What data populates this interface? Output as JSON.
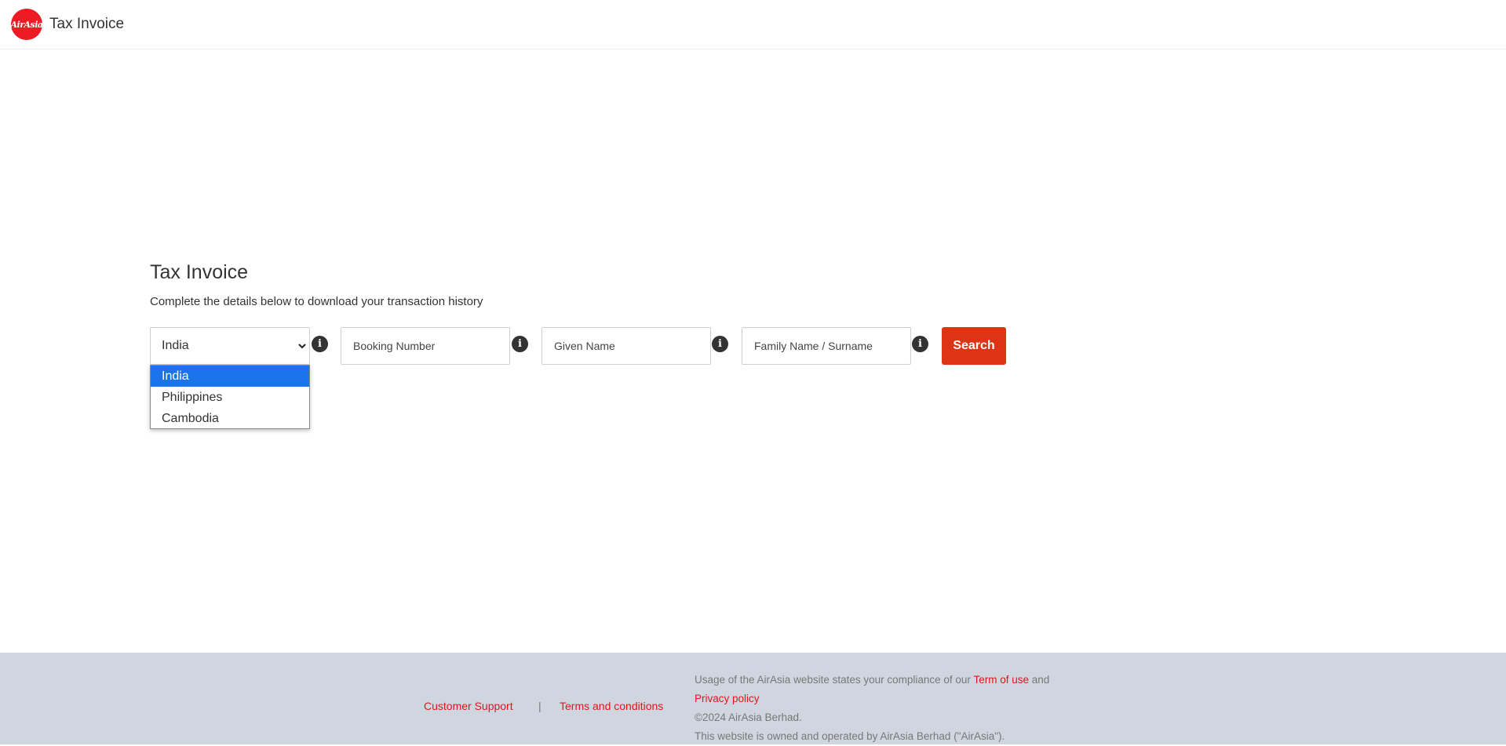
{
  "header": {
    "logo_text": "AirAsia",
    "title": "Tax Invoice"
  },
  "main": {
    "title": "Tax Invoice",
    "subtitle": "Complete the details below to download your transaction history",
    "country_select": {
      "value": "India",
      "options": [
        "India",
        "Philippines",
        "Cambodia"
      ]
    },
    "booking_number": {
      "placeholder": "Booking Number",
      "value": ""
    },
    "given_name": {
      "placeholder": "Given Name",
      "value": ""
    },
    "family_name": {
      "placeholder": "Family Name / Surname",
      "value": ""
    },
    "search_label": "Search",
    "info_icon_glyph": "i"
  },
  "footer": {
    "customer_support": "Customer Support",
    "separator": "|",
    "terms": "Terms and conditions",
    "legal_prefix": "Usage of the AirAsia website states your compliance of our",
    "term_of_use": "Term of use",
    "legal_and": "and",
    "privacy_policy": "Privacy policy",
    "copyright": "©2024 AirAsia Berhad.",
    "ownership": "This website is owned and operated by AirAsia Berhad (\"AirAsia\")."
  },
  "colors": {
    "brand_red": "#ed1c24",
    "search_button": "#dc3414",
    "footer_bg": "#d0d6e0",
    "link_red": "#e0141e",
    "dropdown_highlight": "#1a73e8"
  },
  "icons": [
    "airasia-logo",
    "chevron-down-icon",
    "info-icon"
  ]
}
